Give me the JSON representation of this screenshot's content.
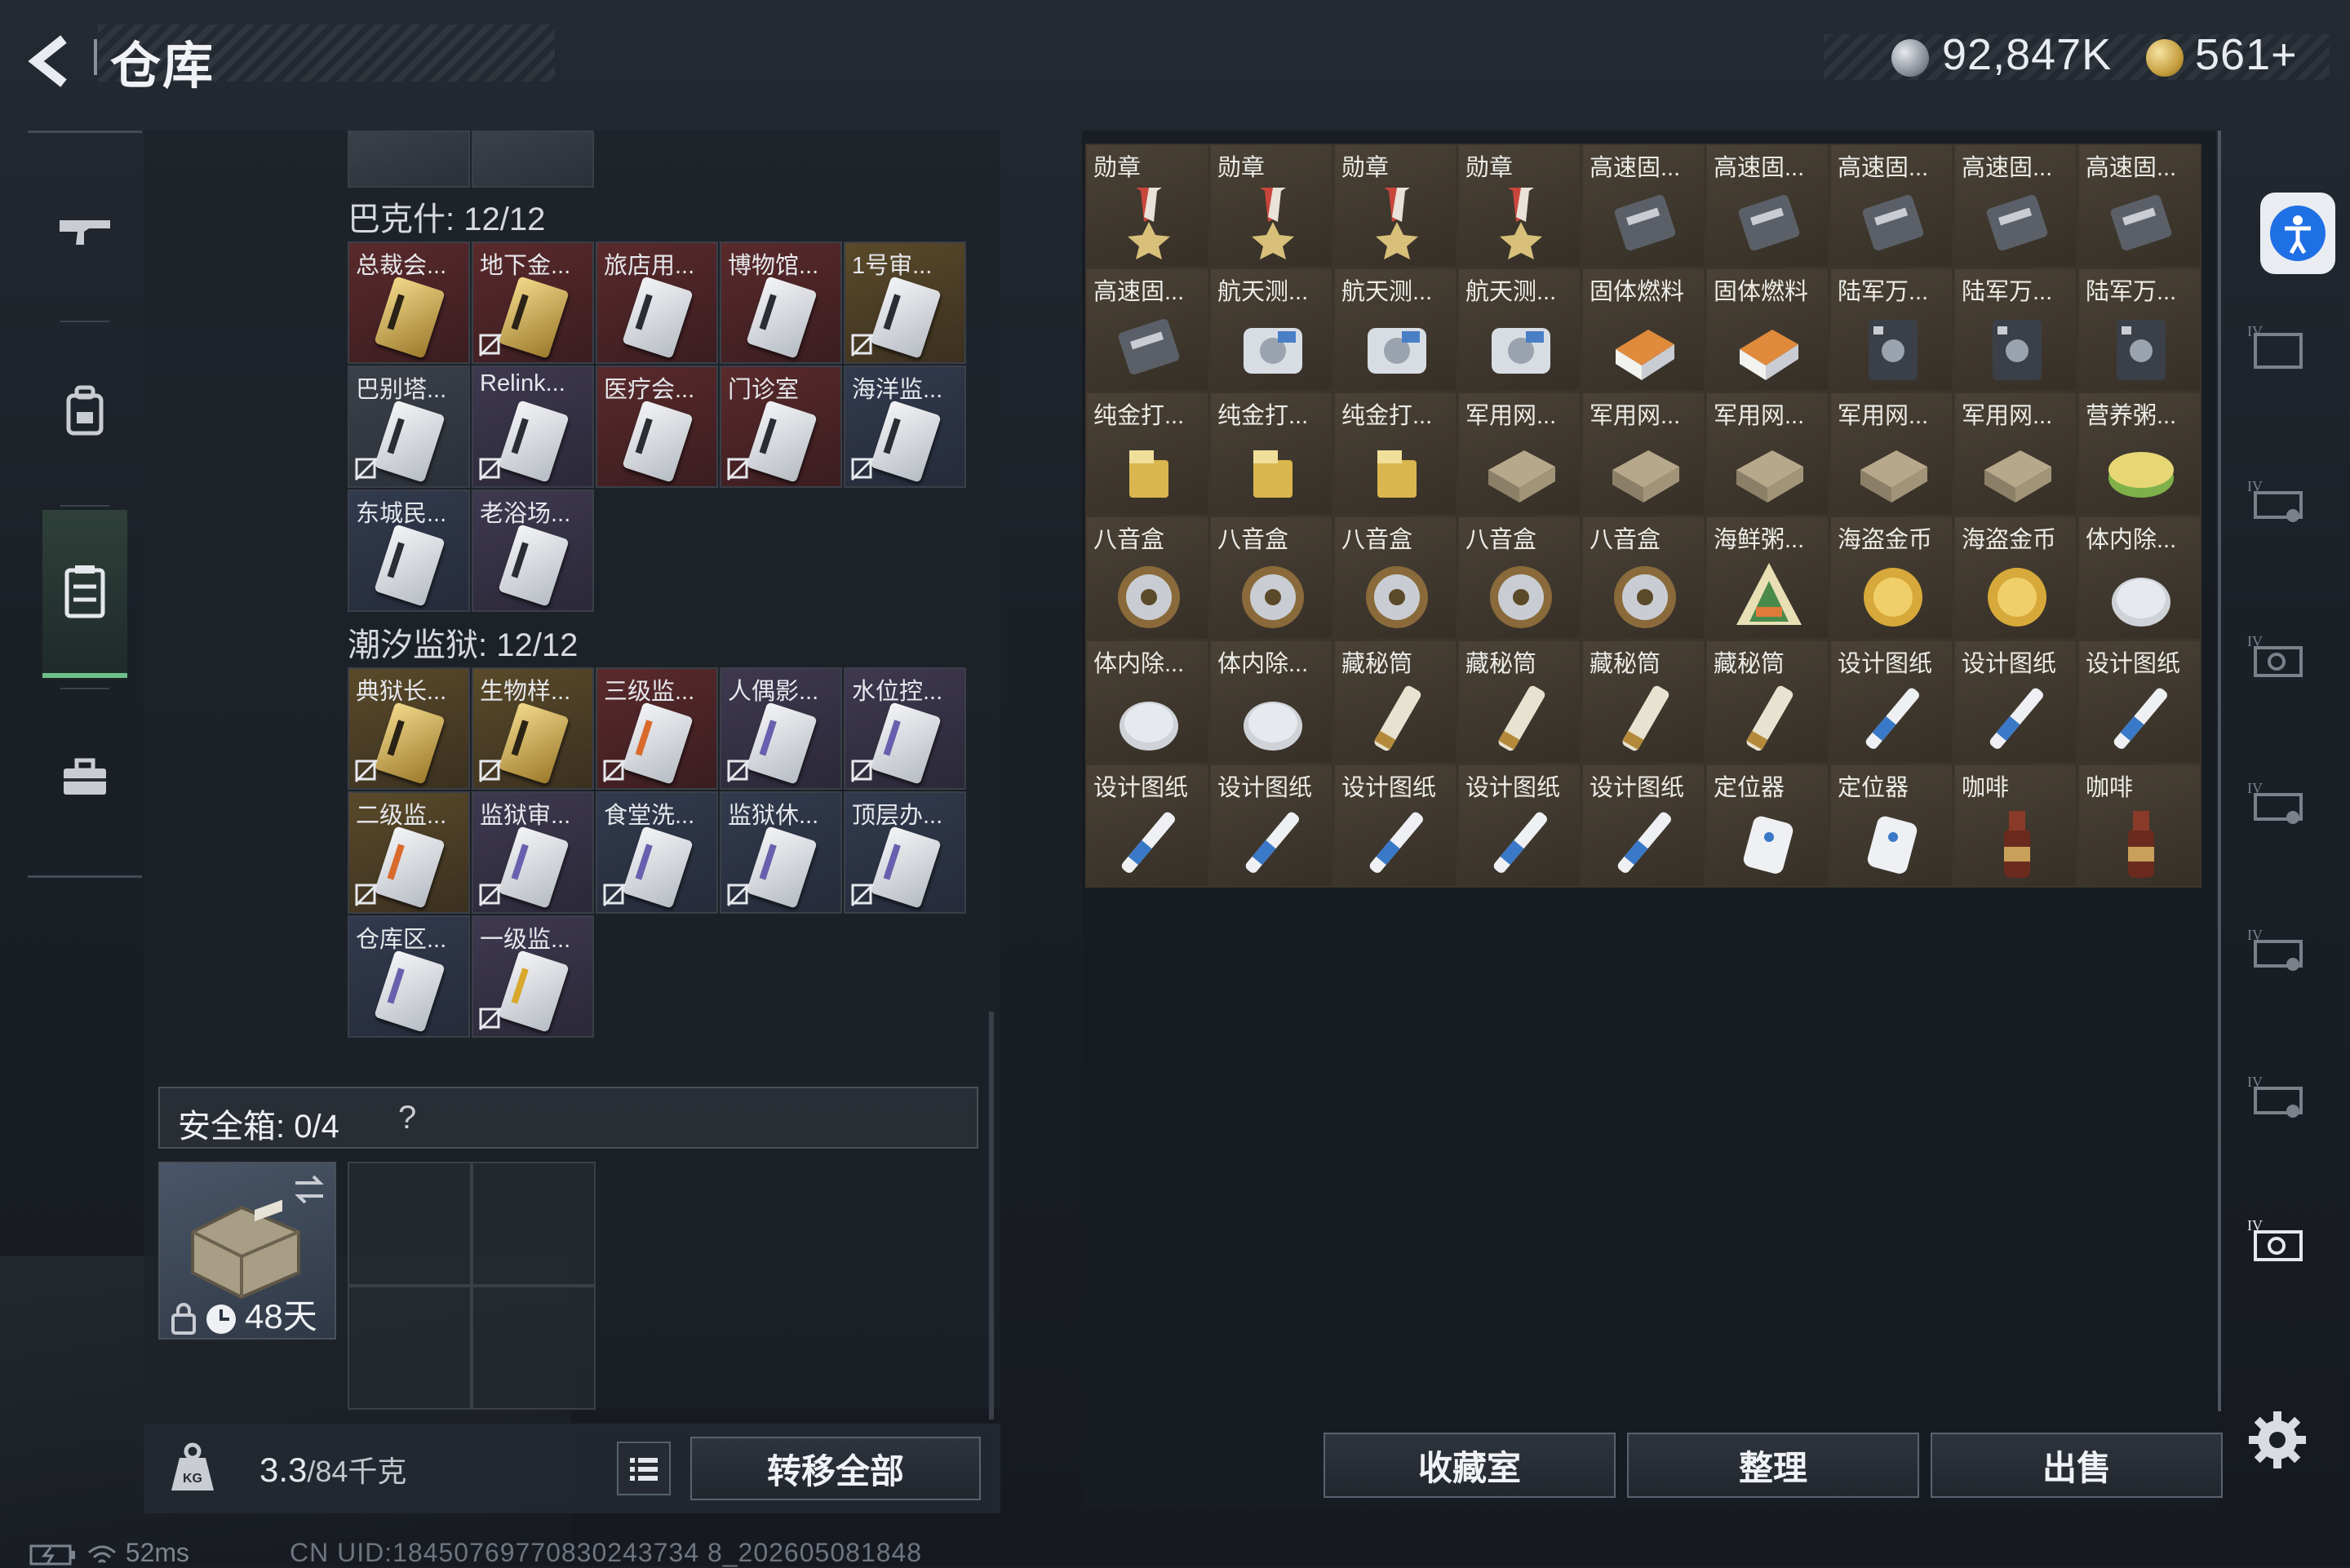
{
  "header": {
    "title": "仓库",
    "currency_silver": "92,847K",
    "currency_gold": "561+"
  },
  "left_rail": {
    "items": [
      "weapon-icon",
      "backpack-icon",
      "chest-rig-icon",
      "toolbox-icon"
    ],
    "active": "chest-rig-icon"
  },
  "sections": [
    {
      "label": "巴克什: 12/12",
      "items": [
        "总裁会...",
        "地下金...",
        "旅店用...",
        "博物馆...",
        "1号审...",
        "巴别塔...",
        "Relink...",
        "医疗会...",
        "门诊室",
        "海洋监...",
        "东城民...",
        "老浴场..."
      ]
    },
    {
      "label": "潮汐监狱: 12/12",
      "items": [
        "典狱长...",
        "生物样...",
        "三级监...",
        "人偶影...",
        "水位控...",
        "二级监...",
        "监狱审...",
        "食堂洗...",
        "监狱休...",
        "顶层办...",
        "仓库区...",
        "一级监..."
      ]
    }
  ],
  "safe_box": {
    "label": "安全箱: 0/4",
    "help": "?",
    "days": "48天"
  },
  "bottom_left": {
    "weight_value": "3.3",
    "weight_unit": "/84千克",
    "transfer_all": "转移全部"
  },
  "storage": {
    "items": [
      "勋章",
      "勋章",
      "勋章",
      "勋章",
      "高速固...",
      "高速固...",
      "高速固...",
      "高速固...",
      "高速固...",
      "高速固...",
      "航天测...",
      "航天测...",
      "航天测...",
      "固体燃料",
      "固体燃料",
      "陆军万...",
      "陆军万...",
      "陆军万...",
      "纯金打...",
      "纯金打...",
      "纯金打...",
      "军用网...",
      "军用网...",
      "军用网...",
      "军用网...",
      "军用网...",
      "营养粥...",
      "八音盒",
      "八音盒",
      "八音盒",
      "八音盒",
      "八音盒",
      "海鲜粥...",
      "海盗金币",
      "海盗金币",
      "体内除...",
      "体内除...",
      "体内除...",
      "藏秘筒",
      "藏秘筒",
      "藏秘筒",
      "藏秘筒",
      "设计图纸",
      "设计图纸",
      "设计图纸",
      "设计图纸",
      "设计图纸",
      "设计图纸",
      "设计图纸",
      "设计图纸",
      "定位器",
      "定位器",
      "咖啡",
      "咖啡"
    ]
  },
  "bottom_right": {
    "collection": "收藏室",
    "sort": "整理",
    "sell": "出售"
  },
  "status_bar": {
    "ping": "52ms",
    "uid": "CN UID:18450769770830243734 8_202605081848"
  }
}
